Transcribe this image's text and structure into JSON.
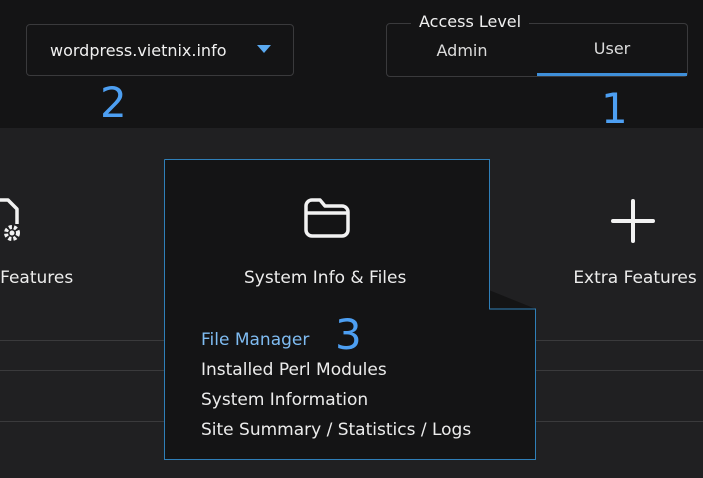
{
  "domain_selector": {
    "value": "wordpress.vietnix.info",
    "icon": "chevron-down-icon"
  },
  "access_level": {
    "legend": "Access Level",
    "options": [
      "Admin",
      "User"
    ],
    "selected": "User"
  },
  "markers": {
    "one": "1",
    "two": "2",
    "three": "3"
  },
  "features": {
    "left_partial": "l Features",
    "center": "System Info & Files",
    "right": "Extra Features"
  },
  "submenu": {
    "items": [
      "File Manager",
      "Installed Perl Modules",
      "System Information",
      "Site Summary / Statistics / Logs"
    ],
    "active_index": 0
  },
  "colors": {
    "accent": "#3f8fd9",
    "active_link": "#7fbcf2",
    "marker": "#4d9ff2"
  }
}
